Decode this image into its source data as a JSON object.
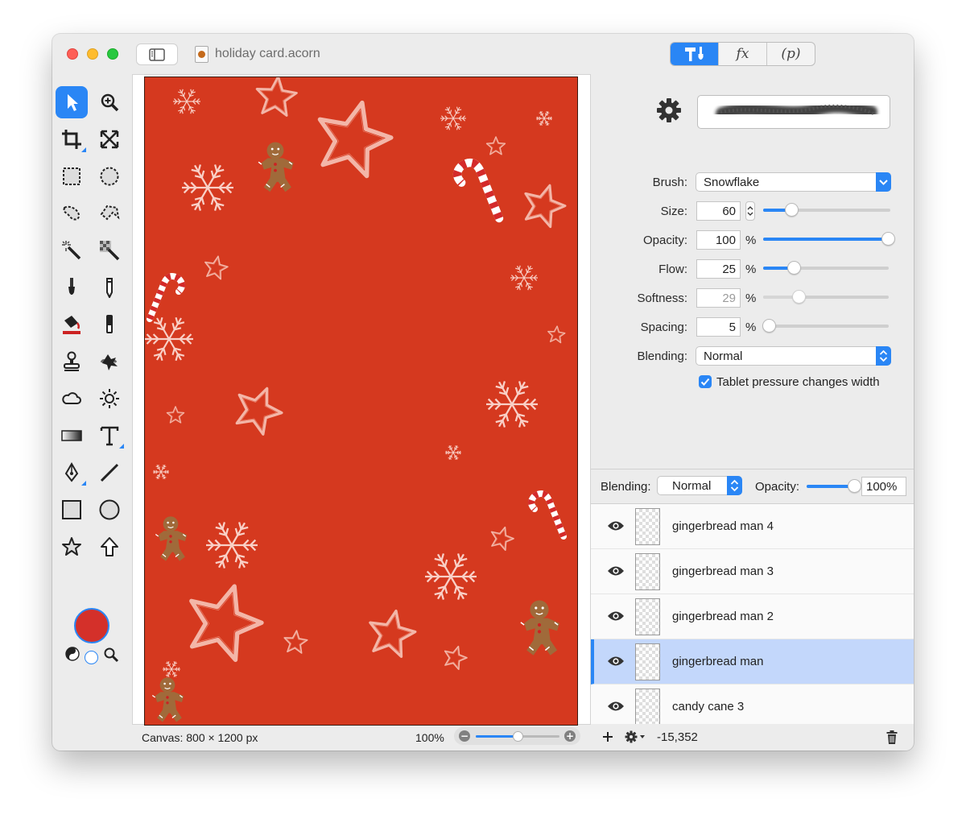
{
  "window": {
    "title": "holiday card.acorn",
    "mode_tabs": [
      {
        "name": "tools",
        "icon": "hammer-brush-icon",
        "active": true
      },
      {
        "name": "effects",
        "label": "fx",
        "active": false
      },
      {
        "name": "plugins",
        "label": "(p)",
        "active": false
      }
    ]
  },
  "tools": [
    {
      "name": "arrow-tool",
      "icon": "arrow-icon",
      "selected": true
    },
    {
      "name": "zoom-tool",
      "icon": "magnifier-plus-icon"
    },
    {
      "name": "crop-tool",
      "icon": "crop-icon"
    },
    {
      "name": "transform-tool",
      "icon": "expand-arrows-icon"
    },
    {
      "name": "rect-select-tool",
      "icon": "dashed-square-icon"
    },
    {
      "name": "ellipse-select-tool",
      "icon": "dashed-circle-icon"
    },
    {
      "name": "lasso-tool",
      "icon": "lasso-icon"
    },
    {
      "name": "polygon-lasso-tool",
      "icon": "polygon-lasso-icon"
    },
    {
      "name": "magic-wand-tool",
      "icon": "magic-wand-icon"
    },
    {
      "name": "instant-alpha-tool",
      "icon": "instant-alpha-icon"
    },
    {
      "name": "brush-tool",
      "icon": "brush-icon"
    },
    {
      "name": "pencil-tool",
      "icon": "pencil-icon"
    },
    {
      "name": "paint-bucket-tool",
      "icon": "paint-bucket-icon"
    },
    {
      "name": "eraser-tool",
      "icon": "eraser-icon"
    },
    {
      "name": "clone-tool",
      "icon": "stamp-icon"
    },
    {
      "name": "smudge-tool",
      "icon": "smudge-icon"
    },
    {
      "name": "cloud-tool",
      "icon": "cloud-icon"
    },
    {
      "name": "light-tool",
      "icon": "sun-icon"
    },
    {
      "name": "gradient-tool",
      "icon": "gradient-icon"
    },
    {
      "name": "text-tool",
      "icon": "text-icon"
    },
    {
      "name": "pen-tool",
      "icon": "pen-nib-icon"
    },
    {
      "name": "line-tool",
      "icon": "line-icon"
    },
    {
      "name": "rectangle-tool",
      "icon": "rectangle-icon"
    },
    {
      "name": "oval-tool",
      "icon": "circle-icon"
    },
    {
      "name": "star-tool",
      "icon": "star-icon"
    },
    {
      "name": "arrow-shape-tool",
      "icon": "up-arrow-icon"
    }
  ],
  "colors": {
    "accent": "#2a86f5",
    "foreground": "#d4302a",
    "background": "#ffffff",
    "canvas_fill": "#d5391f"
  },
  "canvas": {
    "size_text": "Canvas: 800 × 1200 px",
    "zoom_text": "100%",
    "zoom_level": 0.5
  },
  "brush_panel": {
    "brush_label": "Brush:",
    "brush_value": "Snowflake",
    "size_label": "Size:",
    "size_value": "60",
    "size_level": 0.23,
    "opacity_label": "Opacity:",
    "opacity_value": "100",
    "opacity_level": 1.0,
    "flow_label": "Flow:",
    "flow_value": "25",
    "flow_level": 0.25,
    "softness_label": "Softness:",
    "softness_value": "29",
    "softness_level": 0.29,
    "spacing_label": "Spacing:",
    "spacing_value": "5",
    "spacing_level": 0.05,
    "percent": "%",
    "blending_label": "Blending:",
    "blending_value": "Normal",
    "tablet_label": "Tablet pressure changes width",
    "tablet_checked": true
  },
  "layers": {
    "blending_label": "Blending:",
    "blending_value": "Normal",
    "opacity_label": "Opacity:",
    "opacity_value": "100%",
    "opacity_level": 1.0,
    "items": [
      {
        "name": "gingerbread man 4",
        "selected": false
      },
      {
        "name": "gingerbread man 3",
        "selected": false
      },
      {
        "name": "gingerbread man 2",
        "selected": false
      },
      {
        "name": "gingerbread man",
        "selected": true
      },
      {
        "name": "candy cane 3",
        "selected": false
      }
    ],
    "footer_value": "-15,352"
  }
}
